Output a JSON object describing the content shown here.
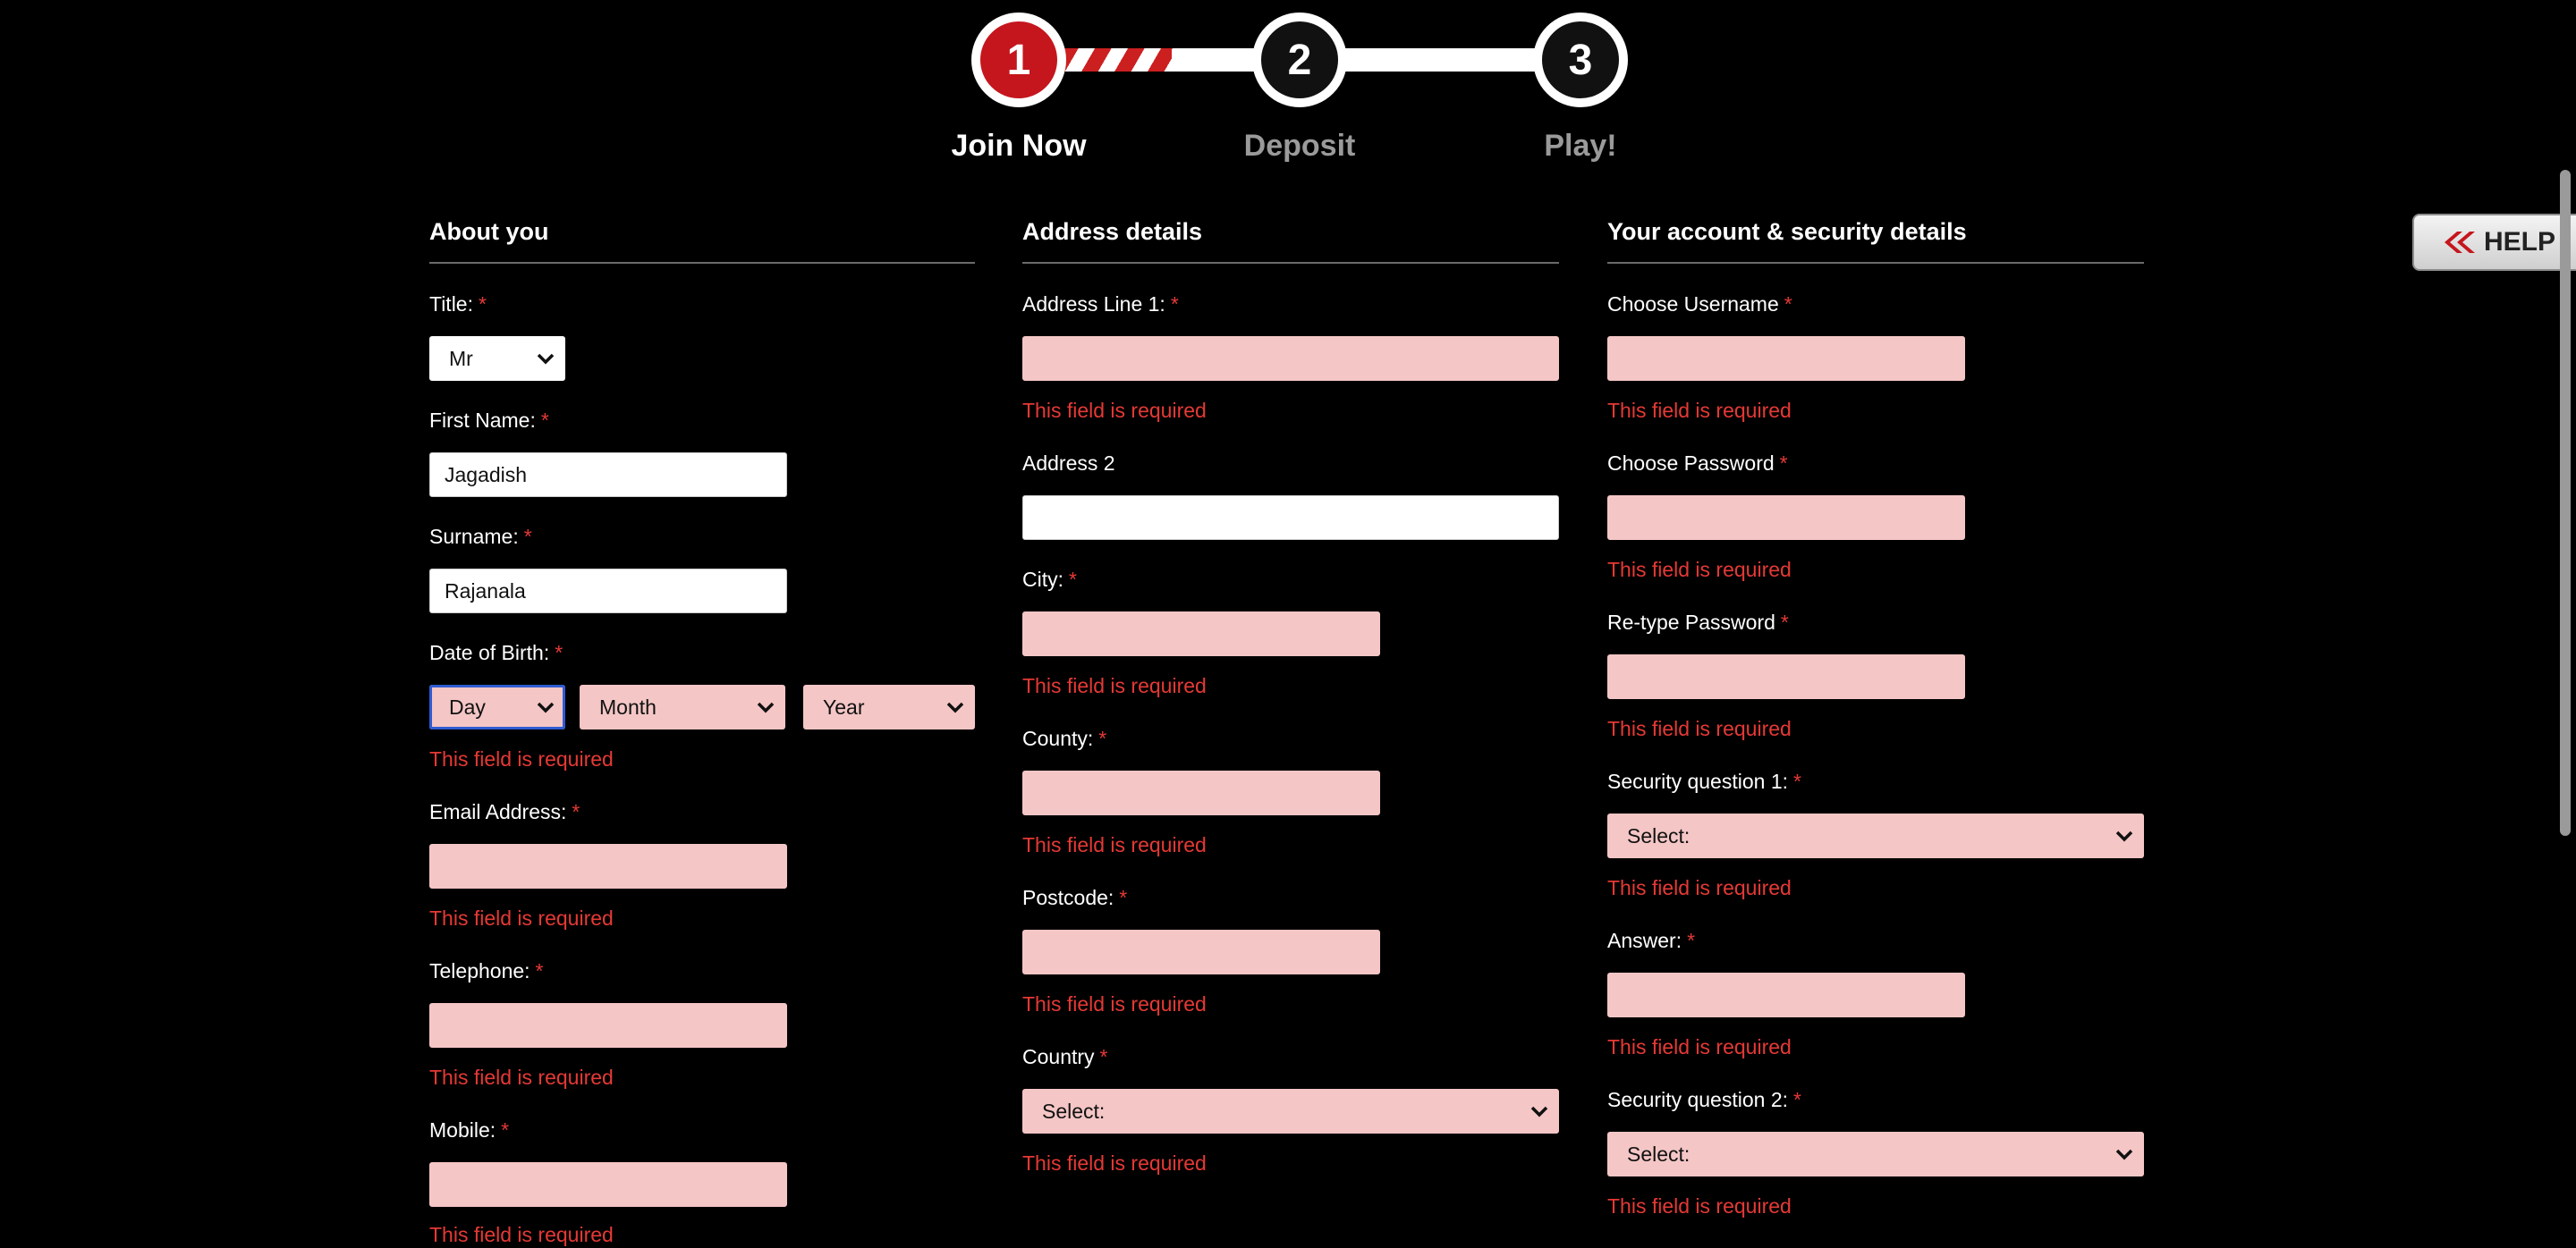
{
  "stepper": {
    "steps": [
      {
        "number": "1",
        "label": "Join Now"
      },
      {
        "number": "2",
        "label": "Deposit"
      },
      {
        "number": "3",
        "label": "Play!"
      }
    ]
  },
  "help": {
    "label": "HELP",
    "icon": "double-chevron-left-icon"
  },
  "error_text": "This field is required",
  "required_mark": "*",
  "about": {
    "title": "About you",
    "title_field": {
      "label": "Title:",
      "value": "Mr"
    },
    "first_name": {
      "label": "First Name:",
      "value": "Jagadish"
    },
    "surname": {
      "label": "Surname:",
      "value": "Rajanala"
    },
    "dob": {
      "label": "Date of Birth:",
      "day": "Day",
      "month": "Month",
      "year": "Year"
    },
    "email": {
      "label": "Email Address:",
      "value": ""
    },
    "telephone": {
      "label": "Telephone:",
      "value": ""
    },
    "mobile": {
      "label": "Mobile:",
      "value": ""
    }
  },
  "address": {
    "title": "Address details",
    "line1": {
      "label": "Address Line 1:",
      "value": ""
    },
    "line2": {
      "label": "Address 2",
      "value": ""
    },
    "city": {
      "label": "City:",
      "value": ""
    },
    "county": {
      "label": "County:",
      "value": ""
    },
    "postcode": {
      "label": "Postcode:",
      "value": ""
    },
    "country": {
      "label": "Country",
      "value": "Select:"
    }
  },
  "account": {
    "title": "Your account & security details",
    "username": {
      "label": "Choose Username",
      "value": ""
    },
    "password": {
      "label": "Choose Password",
      "value": ""
    },
    "retype": {
      "label": "Re-type Password",
      "value": ""
    },
    "question1": {
      "label": "Security question 1:",
      "value": "Select:"
    },
    "answer": {
      "label": "Answer:",
      "value": ""
    },
    "question2": {
      "label": "Security question 2:",
      "value": "Select:"
    }
  },
  "colors": {
    "accent_red": "#c5161d",
    "error_red": "#e53935",
    "error_field_bg": "#f5c6c6",
    "background": "#000000"
  }
}
